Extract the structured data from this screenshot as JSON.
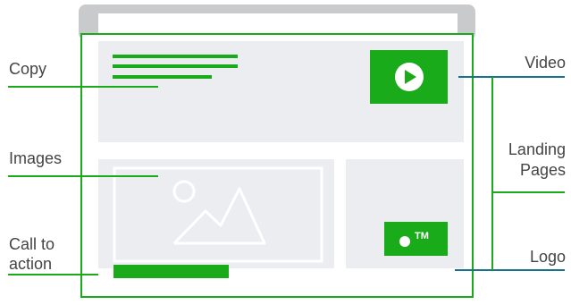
{
  "labels": {
    "copy": "Copy",
    "images": "Images",
    "call_to_action_line1": "Call to",
    "call_to_action_line2": "action",
    "video": "Video",
    "landing_line1": "Landing",
    "landing_line2": "Pages",
    "logo": "Logo",
    "trademark": "TM"
  },
  "colors": {
    "green": "#1aab1a",
    "teal": "#18718a",
    "panel": "#ebedf0",
    "browser_chrome": "#c8cacc",
    "label_text": "#444444",
    "placeholder_stroke": "#ffffff"
  },
  "icons": {
    "video": "play-icon",
    "image": "image-placeholder-icon",
    "logo": "logo-dot-icon"
  }
}
